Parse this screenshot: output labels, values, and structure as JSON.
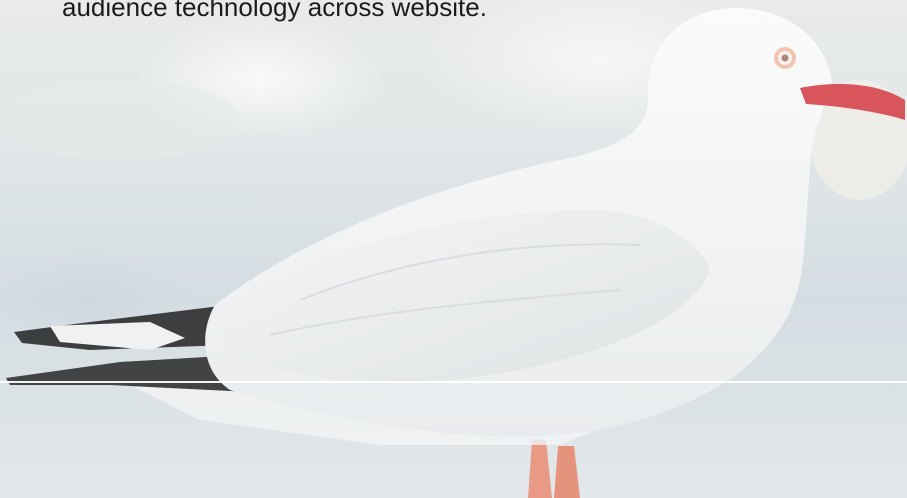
{
  "hero": {
    "headline": "audience technology across website.",
    "image_subject": "seagull standing"
  }
}
